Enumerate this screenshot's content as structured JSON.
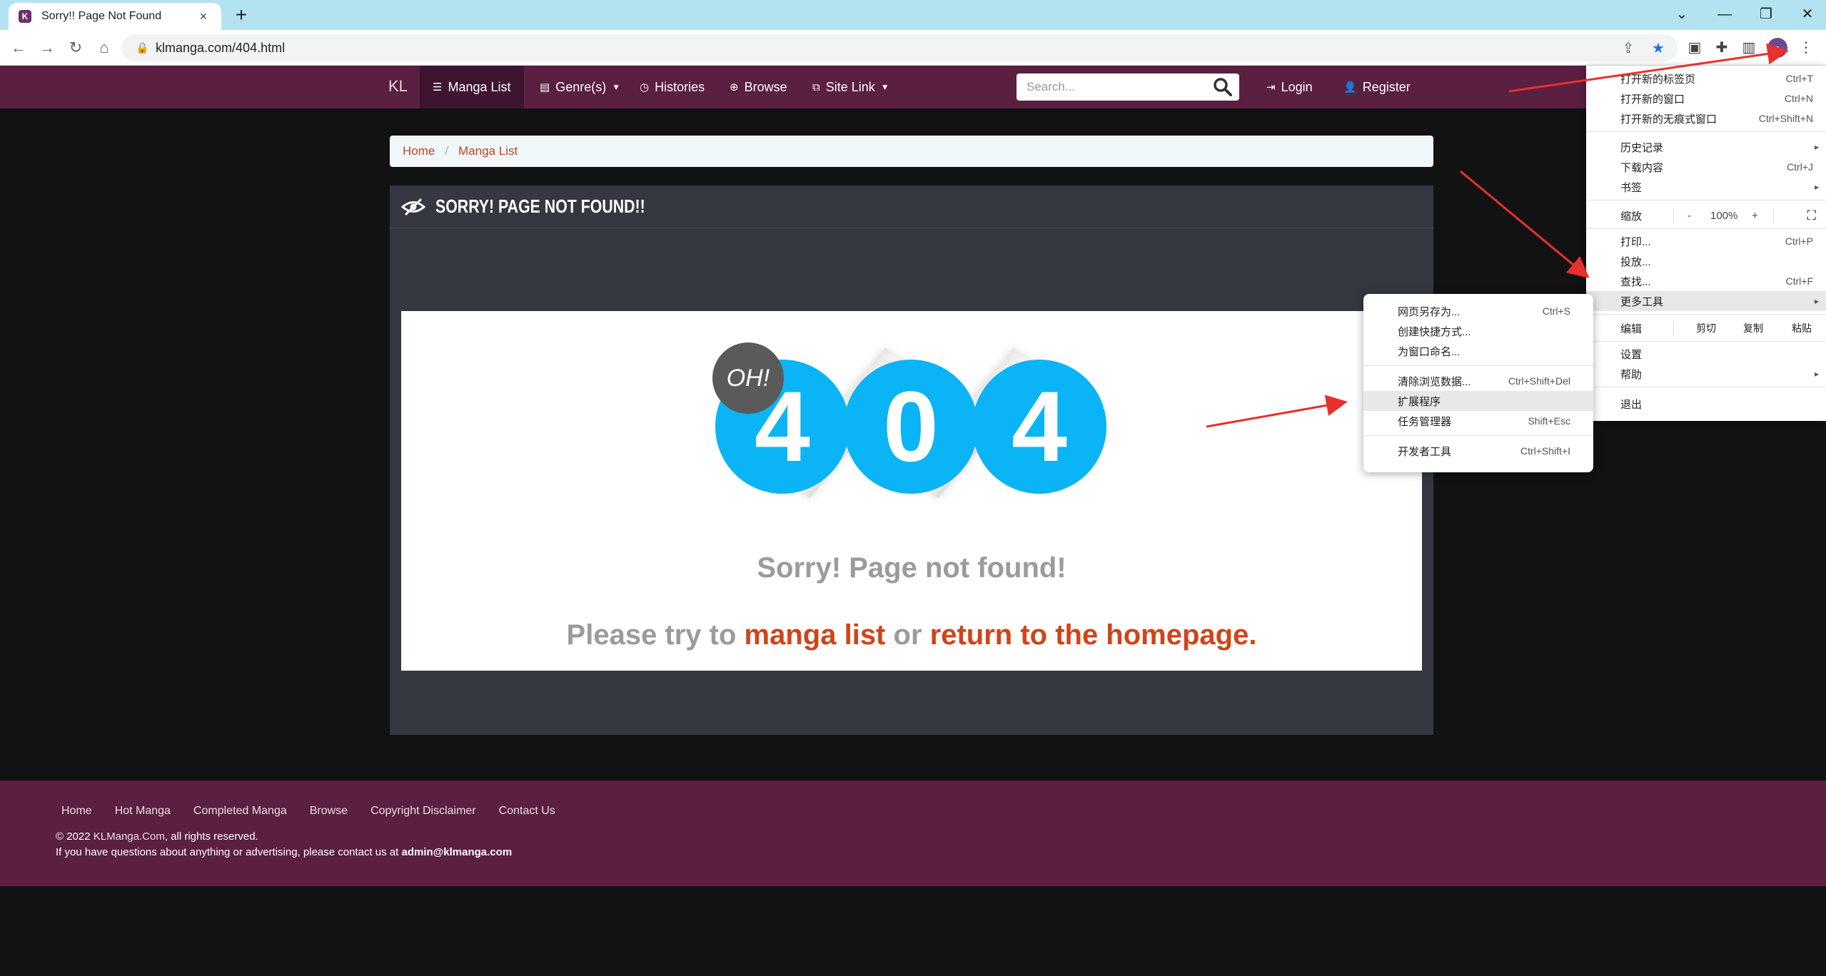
{
  "browser": {
    "tab_title": "Sorry!! Page Not Found",
    "url": "klmanga.com/404.html",
    "favicon_letter": "K",
    "close_glyph": "×",
    "newtab_glyph": "+",
    "win_min": "⌄",
    "win_minimize": "—",
    "win_restore": "❐",
    "win_close": "✕"
  },
  "site": {
    "brand": "KL",
    "nav": [
      {
        "label": "Manga List",
        "icon": "list-icon"
      },
      {
        "label": "Genre(s)",
        "icon": "tag-icon"
      },
      {
        "label": "Histories",
        "icon": "clock-icon"
      },
      {
        "label": "Browse",
        "icon": "magnifier-icon"
      },
      {
        "label": "Site Link",
        "icon": "external-link-icon"
      }
    ],
    "search_placeholder": "Search...",
    "login": "Login",
    "register": "Register"
  },
  "breadcrumb": {
    "home": "Home",
    "separator": "/",
    "current": "Manga List"
  },
  "panel": {
    "title": "SORRY! PAGE NOT FOUND!!"
  },
  "error": {
    "badge": "OH!",
    "digits": [
      "4",
      "0",
      "4"
    ],
    "message": "Sorry! Page not found!",
    "suggest_prefix": "Please try to",
    "suggest_link1": "manga list",
    "suggest_mid": "or",
    "suggest_link2": "return to the homepage",
    "suggest_suffix": "."
  },
  "footer": {
    "links": [
      "Home",
      "Hot Manga",
      "Completed Manga",
      "Browse",
      "Copyright Disclaimer",
      "Contact Us"
    ],
    "copyright_prefix": "© 2022",
    "copyright_site": "KLManga.Com",
    "copyright_suffix": ", all rights reserved.",
    "contact_text": "If you have questions about anything or advertising, please contact us at",
    "contact_email": "admin@klmanga.com"
  },
  "chrome_menu": {
    "items": [
      {
        "label": "打开新的标签页",
        "shortcut": "Ctrl+T"
      },
      {
        "label": "打开新的窗口",
        "shortcut": "Ctrl+N"
      },
      {
        "label": "打开新的无痕式窗口",
        "shortcut": "Ctrl+Shift+N"
      },
      {
        "label": "历史记录",
        "submenu": "▸"
      },
      {
        "label": "下载内容",
        "shortcut": "Ctrl+J"
      },
      {
        "label": "书签",
        "submenu": "▸"
      },
      {
        "label": "打印...",
        "shortcut": "Ctrl+P"
      },
      {
        "label": "投放..."
      },
      {
        "label": "查找...",
        "shortcut": "Ctrl+F"
      },
      {
        "label": "更多工具",
        "submenu": "▸"
      },
      {
        "label": "设置"
      },
      {
        "label": "帮助",
        "submenu": "▸"
      },
      {
        "label": "退出"
      }
    ],
    "zoom": {
      "label": "缩放",
      "minus": "-",
      "value": "100%",
      "plus": "+",
      "fullscreen": "⛶"
    },
    "edit": {
      "label": "编辑",
      "cut": "剪切",
      "copy": "复制",
      "paste": "粘贴"
    }
  },
  "more_tools_menu": {
    "items": [
      {
        "label": "网页另存为...",
        "shortcut": "Ctrl+S"
      },
      {
        "label": "创建快捷方式..."
      },
      {
        "label": "为窗口命名..."
      },
      {
        "label": "清除浏览数据...",
        "shortcut": "Ctrl+Shift+Del"
      },
      {
        "label": "扩展程序"
      },
      {
        "label": "任务管理器",
        "shortcut": "Shift+Esc"
      },
      {
        "label": "开发者工具",
        "shortcut": "Ctrl+Shift+I"
      }
    ]
  },
  "colors": {
    "site_nav": "#5a1f41",
    "accent_link": "#d04418",
    "blue_circle": "#0ab4f5",
    "annotation_arrow": "#e8302c"
  }
}
